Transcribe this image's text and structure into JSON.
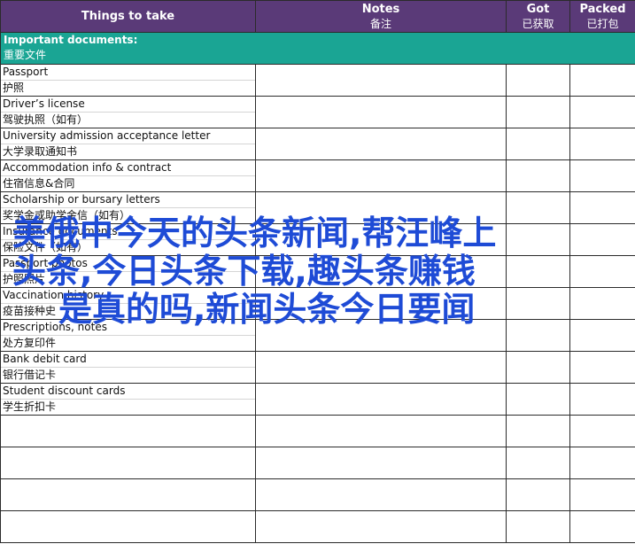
{
  "header": {
    "things_label": "Things to take",
    "notes_en": "Notes",
    "notes_zh": "备注",
    "got_en": "Got",
    "got_zh": "已获取",
    "packed_en": "Packed",
    "packed_zh": "已打包"
  },
  "section": {
    "title_en": "Important documents:",
    "title_zh": "重要文件"
  },
  "items": [
    {
      "en": "Passport",
      "zh": "护照"
    },
    {
      "en": "Driver’s license",
      "zh": "驾驶执照（如有）"
    },
    {
      "en": "University admission acceptance letter",
      "zh": "大学录取通知书"
    },
    {
      "en": "Accommodation info & contract",
      "zh": "住宿信息&合同"
    },
    {
      "en": "Scholarship or bursary letters",
      "zh": "奖学金或助学金信（如有）"
    },
    {
      "en": "Insurance documents",
      "zh": "保险文件（如有）"
    },
    {
      "en": "Passport photos",
      "zh": "护照照片"
    },
    {
      "en": "Vaccination history",
      "zh": "疫苗接种史"
    },
    {
      "en": "Prescriptions, notes",
      "zh": "处方复印件"
    },
    {
      "en": "Bank debit card",
      "zh": "银行借记卡"
    },
    {
      "en": "Student discount cards",
      "zh": "学生折扣卡"
    }
  ],
  "watermark": {
    "line1": "美俄中今天的头条新闻,帮汪峰上",
    "line2": "头条,今日头条下载,趣头条赚钱",
    "line3": "是真的吗,新闻头条今日要闻"
  },
  "colors": {
    "header_bg": "#5a3a78",
    "section_bg": "#1aa594",
    "watermark": "#1e4bd6"
  }
}
